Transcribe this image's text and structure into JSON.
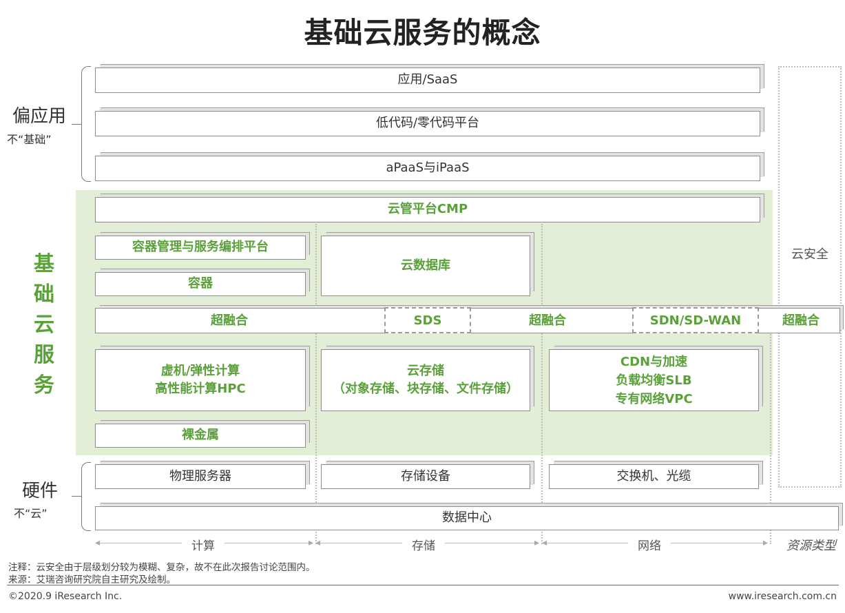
{
  "title": "基础云服务的概念",
  "side": {
    "top_main": "偏应用",
    "top_sub": "不“基础”",
    "middle": [
      "基",
      "础",
      "云",
      "服",
      "务"
    ],
    "bottom_main": "硬件",
    "bottom_sub": "不“云”"
  },
  "security": "云安全",
  "layers": {
    "saas": "应用/SaaS",
    "lowcode": "低代码/零代码平台",
    "apaas": "aPaaS与iPaaS",
    "cmp": "云管平台CMP",
    "container_mgmt": "容器管理与服务编排平台",
    "container": "容器",
    "cloud_db": "云数据库",
    "hci": "超融合",
    "sds": "SDS",
    "sdn": "SDN/SD-WAN",
    "vm_line1": "虚机/弹性计算",
    "vm_line2": "高性能计算HPC",
    "storage_line1": "云存储",
    "storage_line2": "（对象存储、块存储、文件存储）",
    "net_line1": "CDN与加速",
    "net_line2": "负载均衡SLB",
    "net_line3": "专有网络VPC",
    "bare_metal": "裸金属",
    "physical_server": "物理服务器",
    "storage_device": "存储设备",
    "switch": "交换机、光缆",
    "datacenter": "数据中心"
  },
  "axis": {
    "compute": "计算",
    "storage": "存储",
    "network": "网络",
    "type": "资源类型"
  },
  "notes": {
    "note": "注释：云安全由于层级划分较为模糊、复杂，故不在此次报告讨论范围内。",
    "source": "来源：艾瑞咨询研究院自主研究及绘制。"
  },
  "footer": {
    "copyright": "©2020.9 iResearch Inc.",
    "website": "www.iresearch.com.cn"
  }
}
